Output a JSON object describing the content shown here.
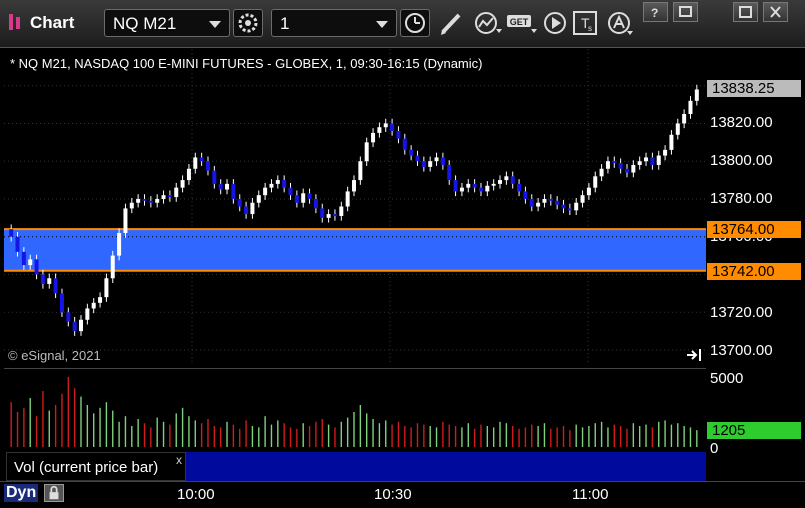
{
  "window": {
    "title": "Chart",
    "symbol": "NQ M21",
    "interval": "1",
    "buttons": [
      "minimize-icon",
      "restore-icon",
      "maximize-icon",
      "close-icon"
    ]
  },
  "toolbar": {
    "icons": [
      "link-settings-icon",
      "clock-icon",
      "pencil-draw-icon",
      "study-icon",
      "get-data-icon",
      "play-replay-icon",
      "text-tool-icon",
      "alert-icon"
    ],
    "get_label": "GET"
  },
  "chart": {
    "header": "* NQ M21, NASDAQ 100 E-MINI FUTURES - GLOBEX, 1, 09:30-16:15 (Dynamic)",
    "copyright": "© eSignal, 2021",
    "price_ticks": [
      "13820.00",
      "13800.00",
      "13780.00",
      "13760.00",
      "13720.00",
      "13700.00"
    ],
    "last_price": "13838.25",
    "upper_line_price": "13764.00",
    "lower_line_price": "13742.00",
    "colors": {
      "up": "#ffffff",
      "down": "#1515e8",
      "band": "#2f67ff",
      "line": "#ff8c00",
      "last_tag": "#bbbbbb"
    }
  },
  "volume": {
    "label": "Vol (current price bar)",
    "close": "x",
    "axis_max": "5000",
    "axis_min": "0",
    "current": "1205",
    "colors": {
      "up": "#7fd07f",
      "down": "#d01c1c",
      "current_tag": "#2ecc2e"
    }
  },
  "time_axis": {
    "labels": [
      "10:00",
      "10:30",
      "11:00"
    ]
  },
  "bottom": {
    "dyn_label": "Dyn"
  },
  "chart_data": {
    "type": "candlestick",
    "title": "* NQ M21, NASDAQ 100 E-MINI FUTURES - GLOBEX, 1, 09:30-16:15 (Dynamic)",
    "ylim": [
      13695,
      13845
    ],
    "x_ticks": [
      "10:00",
      "10:30",
      "11:00"
    ],
    "levels": [
      13764.0,
      13742.0
    ],
    "close_series": [
      13760,
      13752,
      13745,
      13748,
      13740,
      13735,
      13738,
      13730,
      13720,
      13715,
      13710,
      13716,
      13722,
      13725,
      13728,
      13738,
      13750,
      13762,
      13775,
      13778,
      13780,
      13779,
      13778,
      13780,
      13782,
      13781,
      13786,
      13790,
      13796,
      13802,
      13800,
      13795,
      13788,
      13785,
      13788,
      13780,
      13776,
      13772,
      13778,
      13782,
      13786,
      13788,
      13790,
      13786,
      13782,
      13778,
      13783,
      13780,
      13775,
      13770,
      13772,
      13771,
      13776,
      13784,
      13790,
      13800,
      13810,
      13815,
      13818,
      13820,
      13816,
      13812,
      13806,
      13803,
      13800,
      13797,
      13800,
      13802,
      13798,
      13790,
      13784,
      13786,
      13788,
      13786,
      13784,
      13787,
      13788,
      13790,
      13792,
      13788,
      13784,
      13780,
      13776,
      13778,
      13780,
      13779,
      13777,
      13775,
      13774,
      13778,
      13782,
      13786,
      13792,
      13796,
      13800,
      13799,
      13796,
      13794,
      13798,
      13800,
      13802,
      13798,
      13803,
      13806,
      13814,
      13820,
      13825,
      13832,
      13838
    ],
    "volume_series": [
      3200,
      2500,
      2800,
      3500,
      2200,
      4000,
      2600,
      3000,
      3800,
      5000,
      4200,
      3600,
      3000,
      2400,
      2800,
      3200,
      2600,
      1800,
      2200,
      1500,
      2000,
      1700,
      1400,
      2100,
      1800,
      1600,
      2400,
      2800,
      2200,
      1900,
      1700,
      2000,
      1500,
      1400,
      1800,
      1600,
      1300,
      1900,
      1500,
      1400,
      2200,
      1600,
      1900,
      1700,
      1400,
      1300,
      1700,
      1500,
      1800,
      2000,
      1600,
      1400,
      1800,
      2100,
      2500,
      3000,
      2400,
      2000,
      1700,
      1900,
      1600,
      1800,
      1500,
      1400,
      1700,
      1600,
      1500,
      1400,
      1800,
      1600,
      1500,
      1400,
      1700,
      1300,
      1600,
      1500,
      1400,
      1800,
      1700,
      1500,
      1300,
      1400,
      1600,
      1500,
      1700,
      1300,
      1400,
      1500,
      1200,
      1600,
      1400,
      1500,
      1700,
      1800,
      1400,
      1600,
      1500,
      1300,
      1700,
      1500,
      1600,
      1400,
      1800,
      1900,
      1600,
      1700,
      1500,
      1400,
      1205
    ]
  }
}
